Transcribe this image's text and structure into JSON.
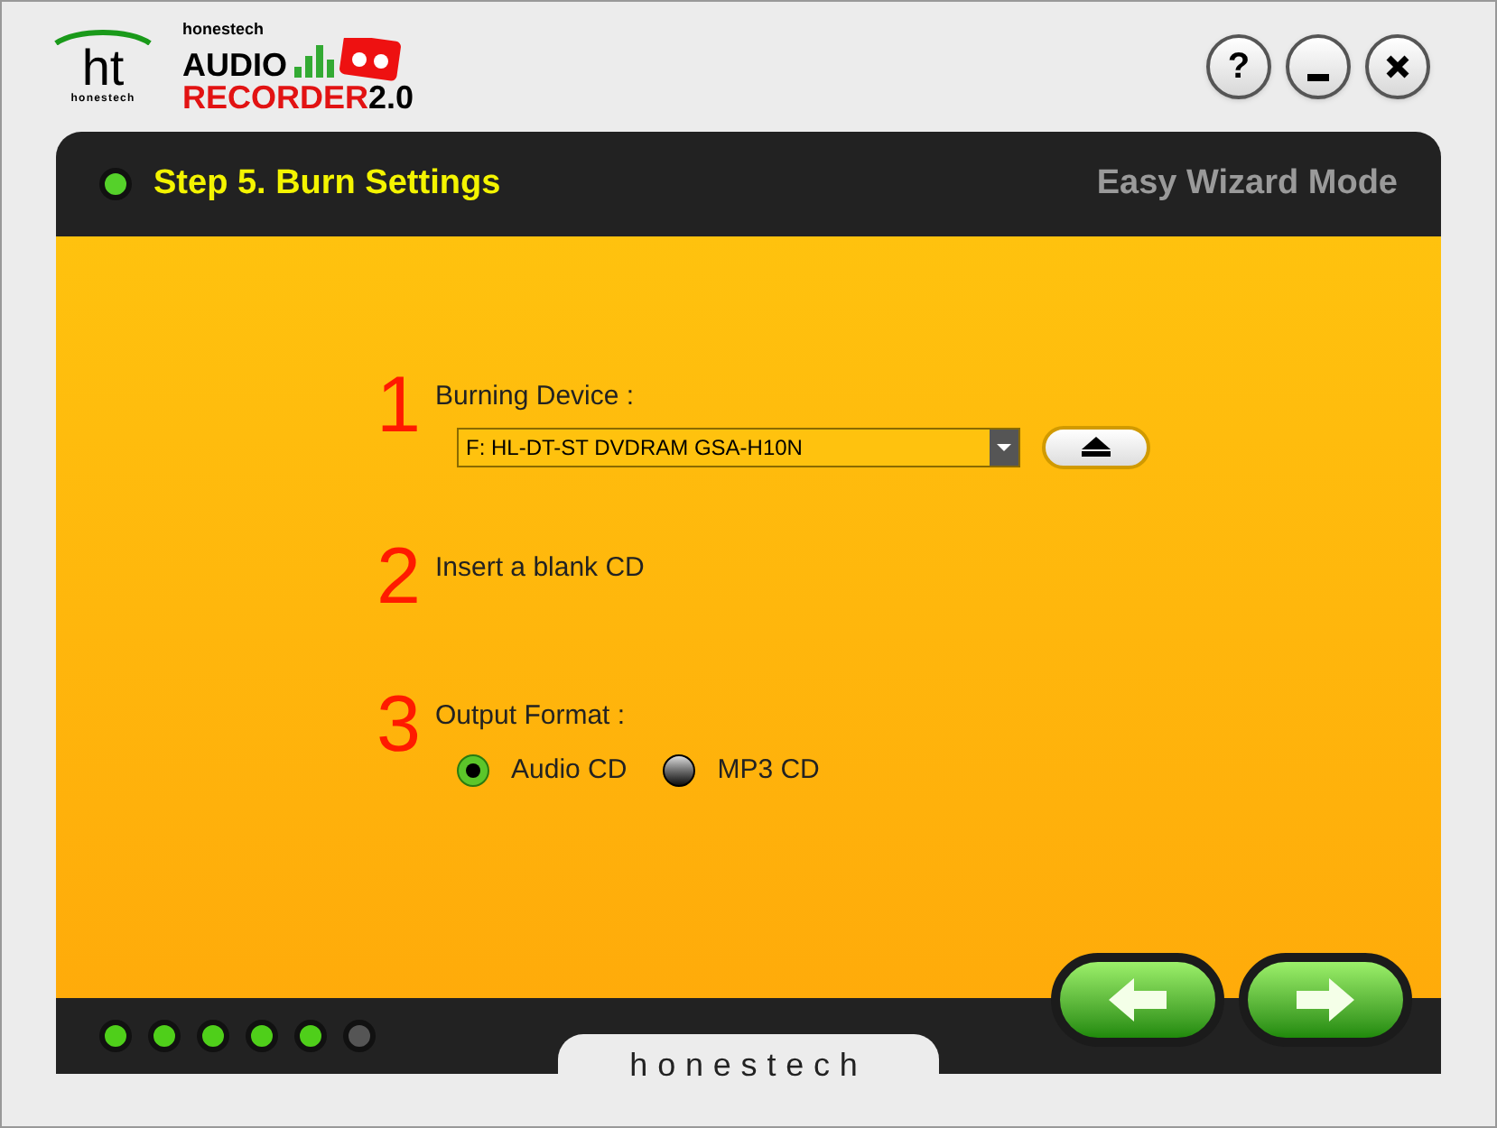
{
  "logo": {
    "mark": "ht",
    "mark_caption": "honestech",
    "brand": "honestech",
    "product_top": "AUDIO",
    "product_bottom": "RECORDER",
    "version": "2.0"
  },
  "window_buttons": [
    {
      "kind": "help",
      "label": "?"
    },
    {
      "kind": "minimize"
    },
    {
      "kind": "close"
    }
  ],
  "header": {
    "title": "Step 5. Burn Settings",
    "mode": "Easy Wizard Mode"
  },
  "steps": [
    {
      "number": "1",
      "kind": "device",
      "label": "Burning Device :",
      "value": "F: HL-DT-ST DVDRAM GSA-H10N"
    },
    {
      "number": "2",
      "kind": "text",
      "label": "Insert a blank CD"
    },
    {
      "number": "3",
      "kind": "radios",
      "label": "Output Format :",
      "options": [
        {
          "label": "Audio CD",
          "selected": true
        },
        {
          "label": "MP3 CD",
          "selected": false
        }
      ]
    }
  ],
  "progress_lights": [
    {
      "on": true
    },
    {
      "on": true
    },
    {
      "on": true
    },
    {
      "on": true
    },
    {
      "on": true
    },
    {
      "on": false
    }
  ],
  "footer": {
    "brand": "honestech"
  },
  "nav_buttons": [
    {
      "kind": "back"
    },
    {
      "kind": "next"
    }
  ]
}
